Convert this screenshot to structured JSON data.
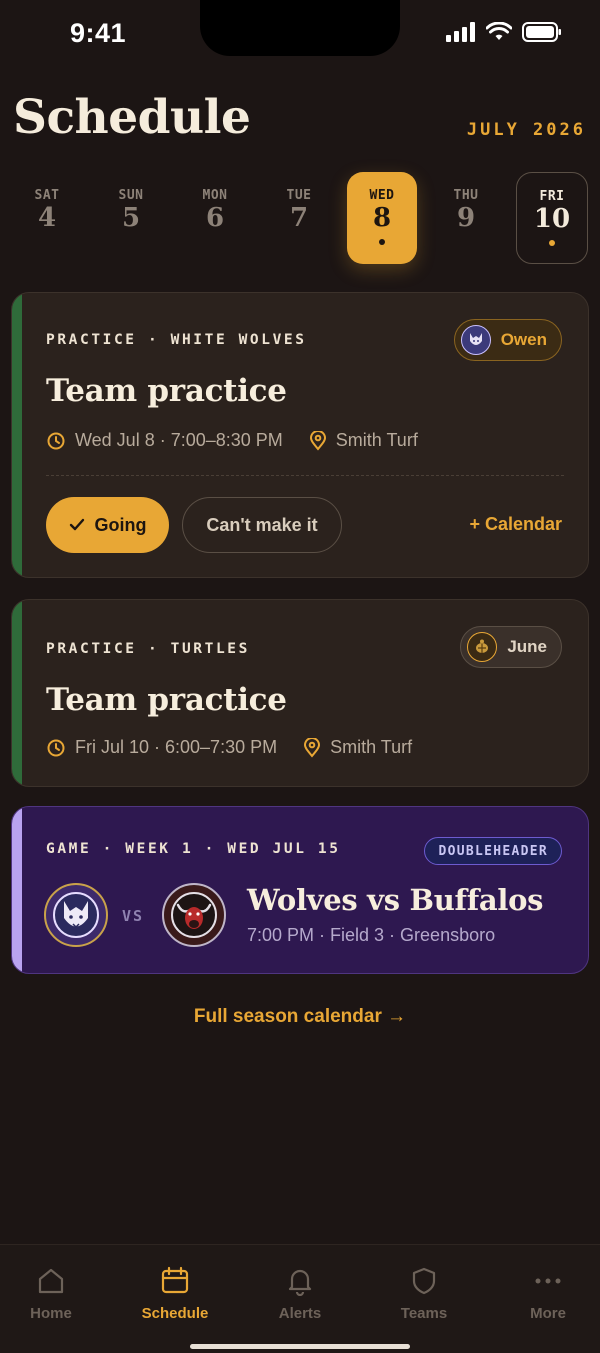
{
  "status": {
    "time": "9:41"
  },
  "header": {
    "title": "Schedule",
    "month": "JULY 2026"
  },
  "week": [
    {
      "name": "SAT",
      "num": "4"
    },
    {
      "name": "SUN",
      "num": "5"
    },
    {
      "name": "MON",
      "num": "6"
    },
    {
      "name": "TUE",
      "num": "7"
    },
    {
      "name": "WED",
      "num": "8",
      "state": "selected",
      "has_event": true
    },
    {
      "name": "THU",
      "num": "9"
    },
    {
      "name": "FRI",
      "num": "10",
      "state": "today",
      "has_event": true
    }
  ],
  "events": [
    {
      "type": "practice",
      "eyebrow": "PRACTICE · WHITE WOLVES",
      "title": "Team practice",
      "datetime": "Wed Jul 8 · 7:00–8:30 PM",
      "location": "Smith Turf",
      "player": "Owen",
      "accent": "#2f6b3a",
      "rsvp": {
        "going_label": "Going",
        "cant_label": "Can't make it",
        "calendar_label": "+ Calendar",
        "selected": "going"
      }
    },
    {
      "type": "practice",
      "eyebrow": "PRACTICE · TURTLES",
      "title": "Team practice",
      "datetime": "Fri Jul 10 · 6:00–7:30 PM",
      "location": "Smith Turf",
      "player": "June",
      "accent": "#2f6b3a"
    },
    {
      "type": "game",
      "eyebrow": "GAME · WEEK 1 · WED JUL 15",
      "badge": "DOUBLEHEADER",
      "vs_label": "VS",
      "matchup": "Wolves vs Buffalos",
      "details": "7:00 PM · Field 3 · Greensboro",
      "accent": "#b9a3f0"
    }
  ],
  "season_link": "Full season calendar →",
  "tabs": [
    {
      "label": "Home",
      "icon": "home-icon"
    },
    {
      "label": "Schedule",
      "icon": "calendar-icon",
      "active": true
    },
    {
      "label": "Alerts",
      "icon": "bell-icon"
    },
    {
      "label": "Teams",
      "icon": "shield-icon"
    },
    {
      "label": "More",
      "icon": "more-icon"
    }
  ],
  "colors": {
    "accent": "#e8a735",
    "background": "#1c1514",
    "card": "#2b221d",
    "game_card": "#2e1850"
  }
}
